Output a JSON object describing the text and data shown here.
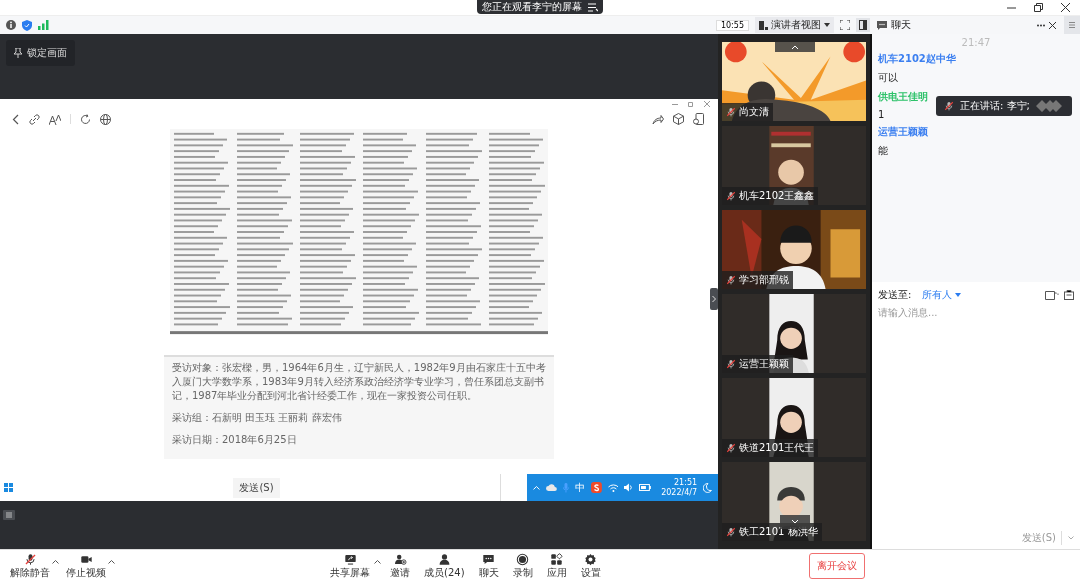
{
  "banner": {
    "text": "您正在观看李宁的屏幕"
  },
  "toolbar": {
    "time": "10:55",
    "view_mode": "演讲者视图"
  },
  "lock_button": "锁定画面",
  "shared_screen": {
    "paragraphs": [
      "受访对象：张宏樑，男，1964年6月生，辽宁新民人，1982年9月由石家庄十五中考入厦门大学数学系，1983年9月转入经济系政治经济学专业学习，曾任系团总支副书记，1987年毕业分配到河北省计经委工作，现在一家投资公司任职。",
      "采访组：石新明 田玉珏 王丽莉 薛宏伟",
      "采访日期：2018年6月25日"
    ],
    "send_button": "发送(S)",
    "tray": {
      "ime": "中",
      "time": "21:51",
      "date": "2022/4/7"
    }
  },
  "videos": [
    {
      "name": "尚文清",
      "muted": true
    },
    {
      "name": "机车2102王鑫鑫",
      "muted": true
    },
    {
      "name": "学习部邢锐",
      "muted": true
    },
    {
      "name": "运营王颖颖",
      "muted": true
    },
    {
      "name": "铁道2101王代王",
      "muted": true
    },
    {
      "name": "铁工2101 杨洪华",
      "muted": true
    }
  ],
  "chat": {
    "title": "聊天",
    "time": "21:47",
    "messages": [
      {
        "sender": "机车2102赵中华",
        "color": "#3b7ff0",
        "text": "可以"
      },
      {
        "sender": "供电王佳明",
        "color": "#2ec26a",
        "text": "1"
      },
      {
        "sender": "运营王颖颖",
        "color": "#3b7ff0",
        "text": "能"
      }
    ],
    "send_to_label": "发送至:",
    "recipient": "所有人",
    "placeholder": "请输入消息...",
    "send_button": "发送(S)"
  },
  "speaking": {
    "text": "正在讲话: 李宁;"
  },
  "controls": [
    {
      "kind": "mic",
      "label": "解除静音",
      "caret": true
    },
    {
      "kind": "video",
      "label": "停止视频",
      "caret": true
    },
    {
      "kind": "share",
      "label": "共享屏幕",
      "caret": true
    },
    {
      "kind": "invite",
      "label": "邀请",
      "caret": false
    },
    {
      "kind": "members",
      "label": "成员(24)",
      "caret": false
    },
    {
      "kind": "chat",
      "label": "聊天",
      "caret": false
    },
    {
      "kind": "record",
      "label": "录制",
      "caret": false
    },
    {
      "kind": "apps",
      "label": "应用",
      "caret": false
    },
    {
      "kind": "settings",
      "label": "设置",
      "caret": false
    }
  ],
  "leave_button": "离开会议"
}
